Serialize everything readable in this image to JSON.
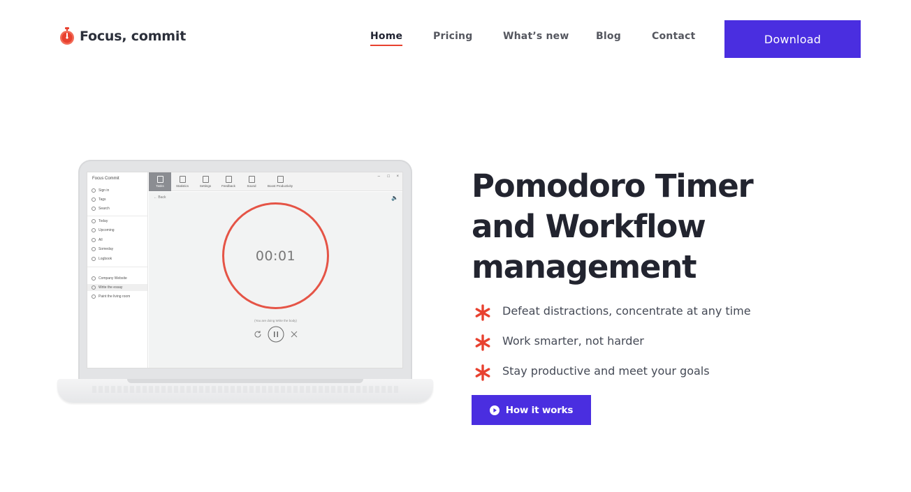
{
  "brand": {
    "name": "Focus, commit",
    "logo_icon": "stopwatch-icon",
    "accent_color": "#e8412f"
  },
  "nav": {
    "items": [
      {
        "label": "Home",
        "active": true
      },
      {
        "label": "Pricing",
        "active": false
      },
      {
        "label": "What’s new",
        "active": false
      },
      {
        "label": "Blog",
        "active": false
      },
      {
        "label": "Contact",
        "active": false
      }
    ],
    "download_label": "Download",
    "button_color": "#4a2ee0"
  },
  "hero": {
    "title_lines": [
      "Pomodoro Timer",
      "and Workflow",
      "management"
    ],
    "features": [
      "Defeat distractions, concentrate at any time",
      "Work smarter, not harder",
      "Stay productive and meet your goals"
    ],
    "feature_icon": "asterisk-icon",
    "cta_label": "How it works",
    "cta_icon": "play-circle-icon"
  },
  "app_preview": {
    "title": "Focus Commit",
    "sidebar": {
      "top": [
        "Sign in",
        "Tags",
        "Search"
      ],
      "lists": [
        "Today",
        "Upcoming",
        "All",
        "Someday",
        "Logbook"
      ],
      "projects": [
        "Company Website",
        "Write the essay",
        "Paint the living room"
      ],
      "selected": "Write the essay"
    },
    "toolbar": [
      "Tasks",
      "Statistics",
      "Settings",
      "Feedback",
      "Sound",
      "Boost Productivity"
    ],
    "active_tool": "Tasks",
    "back_label": "Back",
    "timer": "00:01",
    "doing_text": "(You are doing Write the body)",
    "ring_color": "#e55446"
  }
}
